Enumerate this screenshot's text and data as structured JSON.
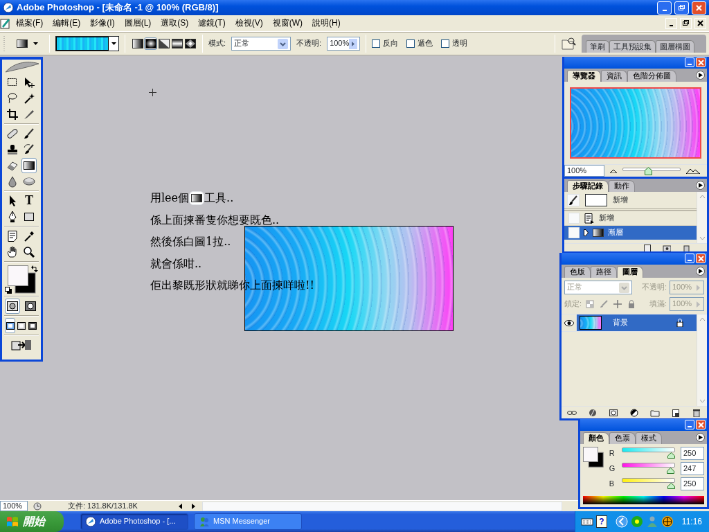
{
  "window": {
    "title": "Adobe Photoshop - [未命名 -1 @ 100% (RGB/8)]"
  },
  "menu": [
    "檔案(F)",
    "編輯(E)",
    "影像(I)",
    "圖層(L)",
    "選取(S)",
    "濾鏡(T)",
    "檢視(V)",
    "視窗(W)",
    "說明(H)"
  ],
  "options_bar": {
    "gradient_types": [
      {
        "kind": "linear",
        "selected": false
      },
      {
        "kind": "radial",
        "selected": true
      },
      {
        "kind": "angle",
        "selected": false
      },
      {
        "kind": "reflected",
        "selected": false
      },
      {
        "kind": "diamond",
        "selected": false
      }
    ],
    "mode_label": "模式:",
    "mode": "正常",
    "opacity_label": "不透明:",
    "opacity": "100%",
    "checkboxes": [
      {
        "label": "反向",
        "checked": false
      },
      {
        "label": "遞色",
        "checked": false
      },
      {
        "label": "透明",
        "checked": false
      }
    ],
    "palette_well_tabs": [
      "筆刷",
      "工具預設集",
      "圖層構圖"
    ]
  },
  "toolbox": {
    "tools": [
      {
        "kind": "marquee",
        "selected": false
      },
      {
        "kind": "move",
        "selected": false
      },
      {
        "kind": "lasso",
        "selected": false
      },
      {
        "kind": "wand",
        "selected": false
      },
      {
        "kind": "crop",
        "selected": false
      },
      {
        "kind": "slice",
        "selected": false
      },
      {
        "kind": "heal",
        "selected": false
      },
      {
        "kind": "brush",
        "selected": false
      },
      {
        "kind": "stamp",
        "selected": false
      },
      {
        "kind": "historybrush",
        "selected": false
      },
      {
        "kind": "eraser",
        "selected": false
      },
      {
        "kind": "gradient",
        "selected": true
      },
      {
        "kind": "blur",
        "selected": false
      },
      {
        "kind": "dodge",
        "selected": false
      },
      {
        "kind": "pathselect",
        "selected": false
      },
      {
        "kind": "type",
        "label": "T",
        "selected": false
      },
      {
        "kind": "pen",
        "selected": false
      },
      {
        "kind": "shape",
        "selected": false
      },
      {
        "kind": "notes",
        "selected": false
      },
      {
        "kind": "eyedropper",
        "selected": false
      },
      {
        "kind": "hand",
        "selected": false
      },
      {
        "kind": "zoom",
        "selected": false
      }
    ],
    "mask_modes": [
      {
        "selected": true
      },
      {
        "selected": false
      }
    ],
    "screen_modes": [
      {
        "selected": true
      },
      {
        "selected": false
      },
      {
        "selected": false
      }
    ]
  },
  "canvas_notes": [
    {
      "text": "用lee個",
      "after": "工具.."
    },
    {
      "text": "係上面揀番隻你想要既色.."
    },
    {
      "text": "然後係白圖1拉.."
    },
    {
      "text": "就會係咁.."
    },
    {
      "text": "佢出黎既形狀就睇你上面揀咩啦!!"
    }
  ],
  "navigator": {
    "tabs": [
      {
        "label": "導覽器",
        "selected": true
      },
      {
        "label": "資訊",
        "selected": false
      },
      {
        "label": "色階分佈圖",
        "selected": false
      }
    ],
    "zoom": "100%",
    "level": 0.43
  },
  "history": {
    "tabs": [
      {
        "label": "步驟記錄",
        "selected": true
      },
      {
        "label": "動作",
        "selected": false
      }
    ],
    "snapshot": "新增",
    "items": [
      {
        "label": "新增",
        "kind": "document",
        "selected": false
      },
      {
        "label": "漸層",
        "kind": "gradient",
        "selected": true
      }
    ]
  },
  "layers": {
    "tabs": [
      {
        "label": "色版",
        "selected": false
      },
      {
        "label": "路徑",
        "selected": false
      },
      {
        "label": "圖層",
        "selected": true
      }
    ],
    "disabled": true,
    "blend_mode": "正常",
    "opacity_label": "不透明:",
    "opacity": "100%",
    "lock_label": "鎖定:",
    "fill_label": "填滿:",
    "fill": "100%",
    "layers": [
      {
        "name": "背景",
        "visible": true,
        "locked": true,
        "selected": true
      }
    ]
  },
  "color": {
    "tabs": [
      {
        "label": "顏色",
        "selected": true
      },
      {
        "label": "色票",
        "selected": false
      },
      {
        "label": "樣式",
        "selected": false
      }
    ],
    "channels": [
      {
        "name": "R",
        "value": "250",
        "level": 0.98
      },
      {
        "name": "G",
        "value": "247",
        "level": 0.97
      },
      {
        "name": "B",
        "value": "250",
        "level": 0.98
      }
    ]
  },
  "status_bar": {
    "zoom": "100%",
    "doc": "文件: 131.8K/131.8K"
  },
  "taskbar": {
    "start": "開始",
    "tasks": [
      {
        "label": "Adobe Photoshop - [...",
        "selected": true
      },
      {
        "label": "MSN Messenger",
        "selected": false
      }
    ],
    "help_label": "?",
    "clock": "11:16"
  }
}
